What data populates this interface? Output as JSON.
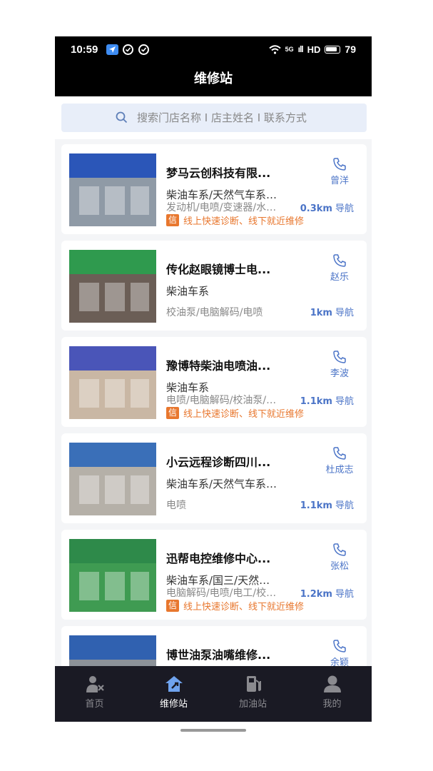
{
  "status_bar": {
    "time": "10:59",
    "network": "5G",
    "signal": "ıll",
    "hd": "HD",
    "battery": "79"
  },
  "header": {
    "title": "维修站"
  },
  "search": {
    "placeholder": "搜索门店名称 I 店主姓名 I 联系方式"
  },
  "stores": [
    {
      "name": "梦马云创科技有限...",
      "tags": "柴油车系/天然气车系…",
      "services": "发动机/电喷/变速器/水…",
      "promo_badge": "信",
      "promo": "线上快速诊断、线下就近维修",
      "contact": "曾洋",
      "distance": "0.3km",
      "nav_label": "导航",
      "photo_colors": {
        "sign": "#2b56b8",
        "building": "#8f9aa6"
      }
    },
    {
      "name": "传化赵眼镜博士电...",
      "tags": "柴油车系",
      "services": "校油泵/电脑解码/电喷",
      "promo_badge": "",
      "promo": "",
      "contact": "赵乐",
      "distance": "1km",
      "nav_label": "导航",
      "photo_colors": {
        "sign": "#2f9a4e",
        "building": "#6b5e56"
      }
    },
    {
      "name": "豫博特柴油电喷油...",
      "tags": "柴油车系",
      "services": "电喷/电脑解码/校油泵/…",
      "promo_badge": "信",
      "promo": "线上快速诊断、线下就近维修",
      "contact": "李波",
      "distance": "1.1km",
      "nav_label": "导航",
      "photo_colors": {
        "sign": "#4a55b8",
        "building": "#c9b7a4"
      }
    },
    {
      "name": "小云远程诊断四川...",
      "tags": "柴油车系/天然气车系…",
      "services": "电喷",
      "promo_badge": "",
      "promo": "",
      "contact": "杜成志",
      "distance": "1.1km",
      "nav_label": "导航",
      "photo_colors": {
        "sign": "#3a6fb8",
        "building": "#b5b0a8"
      }
    },
    {
      "name": "迅帮电控维修中心...",
      "tags": "柴油车系/国三/天然…",
      "services": "电脑解码/电喷/电工/校…",
      "promo_badge": "信",
      "promo": "线上快速诊断、线下就近维修",
      "contact": "张松",
      "distance": "1.2km",
      "nav_label": "导航",
      "photo_colors": {
        "sign": "#2e8a4a",
        "building": "#3f9b52"
      }
    },
    {
      "name": "博世油泵油嘴维修...",
      "tags": "",
      "services": "",
      "promo_badge": "",
      "promo": "",
      "contact": "余颖",
      "distance": "",
      "nav_label": "",
      "photo_colors": {
        "sign": "#3061b0",
        "building": "#8c9299"
      }
    }
  ],
  "tabs": [
    {
      "label": "首页",
      "icon": "mechanic-icon"
    },
    {
      "label": "维修站",
      "icon": "repair-house-icon"
    },
    {
      "label": "加油站",
      "icon": "fuel-pump-icon"
    },
    {
      "label": "我的",
      "icon": "person-icon"
    }
  ],
  "colors": {
    "accent": "#4b74c7",
    "promo": "#e8772e",
    "tabbar": "#1a1a24"
  }
}
